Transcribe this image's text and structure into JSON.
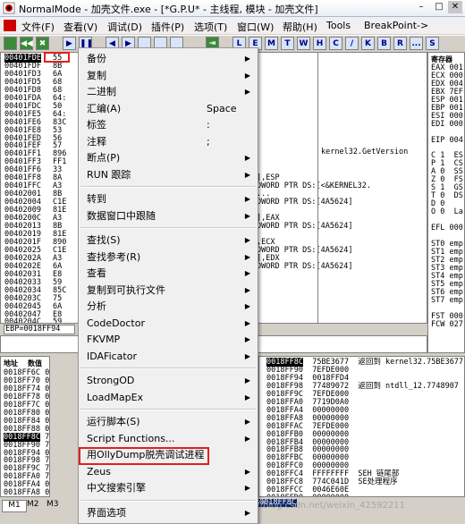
{
  "window": {
    "title": "NormalMode - 加壳文件.exe - [*G.P.U* - 主线程, 模块 - 加壳文件]",
    "min": "–",
    "max": "□",
    "close": "✕"
  },
  "menubar": {
    "items": [
      "文件(F)",
      "查看(V)",
      "调试(D)",
      "插件(P)",
      "选项(T)",
      "窗口(W)",
      "帮助(H)",
      "Tools",
      "BreakPoint->"
    ]
  },
  "toolbar": {
    "left_buttons": [
      "",
      "◀◀",
      "✖",
      "",
      "▶",
      "❚❚",
      "◀",
      "▶",
      "",
      "",
      "",
      "",
      "",
      "⇥"
    ],
    "letter_buttons": [
      "L",
      "E",
      "M",
      "T",
      "W",
      "H",
      "C",
      "/",
      "K",
      "B",
      "R",
      "...",
      "S"
    ]
  },
  "disasm": {
    "addresses": [
      "00401FDE",
      "00401FDF",
      "00401FD3",
      "00401FD5",
      "00401FD8",
      "00401FDA",
      "00401FDC",
      "00401FE5",
      "00401FE6",
      "00401FE8",
      "00401FED",
      "00401FEF",
      "00401FF1",
      "00401FF3",
      "00401FF6",
      "00401FF8",
      "00401FFC",
      "00402001",
      "00402004",
      "00402009",
      "0040200C",
      "00402013",
      "00402019",
      "0040201F",
      "00402025",
      "0040202A",
      "0040202E",
      "00402031",
      "00402033",
      "00402034",
      "0040203C",
      "00402045",
      "00402047",
      "0040204C",
      "0040204E",
      "00402053",
      "00402055",
      "0040205B",
      "0040205D",
      "00402060",
      "00402066",
      "0040206B"
    ],
    "bytes": [
      "55",
      "8B",
      "6A",
      "68",
      "68",
      "64:",
      "50",
      "64:",
      "83C",
      "53",
      "56",
      "57",
      "896",
      "FF1",
      "33",
      "8A",
      "A3",
      "8B",
      "C1E",
      "81E",
      "A3",
      "8B",
      "81E",
      "890",
      "C1E",
      "A3",
      "6A",
      "E8",
      "59",
      "85C",
      "75",
      "6A",
      "E8",
      "59",
      "E8",
      "F3",
      "89",
      "F7",
      "FF",
      "83",
      "31",
      "6A"
    ],
    "ops": [
      "",
      "",
      "",
      "",
      "",
      "",
      "",
      "",
      "",
      "",
      "",
      "",
      "",
      "",
      "",
      "],ESP",
      "DWORD PTR DS:[<&KERNEL32.",
      "...",
      "DWORD PTR DS:[4A5624]",
      "",
      "],EAX",
      "DWORD PTR DS:[4A5624]",
      "",
      ",ECX",
      "DWORD PTR DS:[4A5624]",
      "],EDX",
      "DWORD PTR DS:[4A5624]",
      "",
      "",
      "",
      "",
      "",
      "",
      "",
      "],EAX",
      "",
      "",
      "",
      "",
      "",
      "",
      "",
      ""
    ],
    "comment": "kernel32.GetVersion",
    "footer": "EBP=0018FF94"
  },
  "registers": {
    "header": "寄存器",
    "lines": [
      "EAX 001",
      "ECX 000",
      "EDX 004",
      "EBX 7EF",
      "ESP 001",
      "EBP 001",
      "ESI 000",
      "EDI 000",
      "",
      "EIP 004",
      "",
      "C 1  ES",
      "P 1  CS",
      "A 0  SS",
      "Z 0  FS",
      "S 1  GS",
      "T 0  DS",
      "D 0",
      "O 0  La",
      "",
      "EFL 000",
      "",
      "ST0 emp",
      "ST1 emp",
      "ST2 emp",
      "ST3 emp",
      "ST4 emp",
      "ST5 emp",
      "ST6 emp",
      "ST7 emp",
      "",
      "FST 000",
      "FCW 027"
    ]
  },
  "dump": {
    "headers": [
      "地址",
      "数值"
    ],
    "addresses": [
      "0018FF6C",
      "0018FF70",
      "0018FF74",
      "0018FF78",
      "0018FF7C",
      "0018FF80",
      "0018FF84",
      "0018FF88",
      "0018FF8C",
      "0018FF90",
      "0018FF94",
      "0018FF98",
      "0018FF9C",
      "0018FFA0",
      "0018FFA4",
      "0018FFA8"
    ],
    "values": [
      "0000",
      "0000",
      "0000",
      "0000",
      "0000",
      "0000",
      "0000",
      "0000",
      "75BE",
      "7EFD",
      "0018",
      "7748",
      "7EFD",
      "7719",
      "0000",
      "0000"
    ],
    "addr_highlight": "0018FF8C"
  },
  "stack": {
    "top_addr": "0018FF8C",
    "rows": [
      [
        "0018FF8C",
        "75BE3677",
        "返回到",
        "kernel32.75BE3677"
      ],
      [
        "0018FF90",
        "7EFDE000",
        "",
        ""
      ],
      [
        "0018FF94",
        "0018FFD4",
        "",
        ""
      ],
      [
        "0018FF98",
        "77489072",
        "返回到",
        "ntdll_12.7748907"
      ],
      [
        "0018FF9C",
        "7EFDE000",
        "",
        ""
      ],
      [
        "0018FFA0",
        "7719D0A0",
        "",
        ""
      ],
      [
        "0018FFA4",
        "00000000",
        "",
        ""
      ],
      [
        "0018FFA8",
        "00000000",
        "",
        ""
      ],
      [
        "0018FFAC",
        "7EFDE000",
        "",
        ""
      ],
      [
        "0018FFB0",
        "00000000",
        "",
        ""
      ],
      [
        "0018FFB4",
        "00000000",
        "",
        ""
      ],
      [
        "0018FFB8",
        "00000000",
        "",
        ""
      ],
      [
        "0018FFBC",
        "00000000",
        "",
        ""
      ],
      [
        "0018FFC0",
        "00000000",
        "",
        ""
      ],
      [
        "0018FFC4",
        "FFFFFFFF",
        "SEH",
        "链尾部"
      ],
      [
        "0018FFC8",
        "774C041D",
        "SE处理程序",
        ""
      ],
      [
        "0018FFCC",
        "0046E60E",
        "",
        ""
      ],
      [
        "0018FFD0",
        "00000000",
        "",
        ""
      ],
      [
        "0018FFD4",
        "0018FFEC",
        "",
        ""
      ]
    ],
    "bottom_field": "0018FF8C"
  },
  "statusbar": {
    "tabs": [
      "M1",
      "M2",
      "M3"
    ],
    "watermark": "https://blog.csdn.net/weixin_42592211"
  },
  "context_menu": {
    "items": [
      {
        "label": "备份",
        "arrow": true
      },
      {
        "label": "复制",
        "arrow": true
      },
      {
        "label": "二进制",
        "arrow": true
      },
      {
        "label": "汇编(A)",
        "shortcut": "Space"
      },
      {
        "label": "标签",
        "shortcut": ":"
      },
      {
        "label": "注释",
        "shortcut": ";"
      },
      {
        "label": "断点(P)",
        "arrow": true
      },
      {
        "label": "RUN 跟踪",
        "arrow": true
      },
      {
        "sep": true
      },
      {
        "label": "转到",
        "arrow": true
      },
      {
        "label": "数据窗口中跟随",
        "arrow": true
      },
      {
        "sep": true
      },
      {
        "label": "查找(S)",
        "arrow": true
      },
      {
        "label": "查找参考(R)",
        "arrow": true
      },
      {
        "label": "查看",
        "arrow": true
      },
      {
        "label": "复制到可执行文件",
        "arrow": true
      },
      {
        "label": "分析",
        "arrow": true
      },
      {
        "label": "CodeDoctor",
        "arrow": true
      },
      {
        "label": "FKVMP",
        "arrow": true
      },
      {
        "label": "IDAFicator",
        "arrow": true
      },
      {
        "sep": true
      },
      {
        "label": "StrongOD",
        "arrow": true
      },
      {
        "label": "LoadMapEx",
        "arrow": true
      },
      {
        "sep": true
      },
      {
        "label": "运行脚本(S)",
        "arrow": true
      },
      {
        "label": "Script Functions...",
        "arrow": true
      },
      {
        "label": "用OllyDump脱壳调试进程",
        "arrow": false
      },
      {
        "label": "Zeus",
        "arrow": true
      },
      {
        "label": "中文搜索引擎",
        "arrow": true
      },
      {
        "sep": true
      },
      {
        "label": "界面选项",
        "arrow": true
      }
    ]
  },
  "colors": {
    "highlight_border": "#e02020",
    "selection": "#000000"
  }
}
